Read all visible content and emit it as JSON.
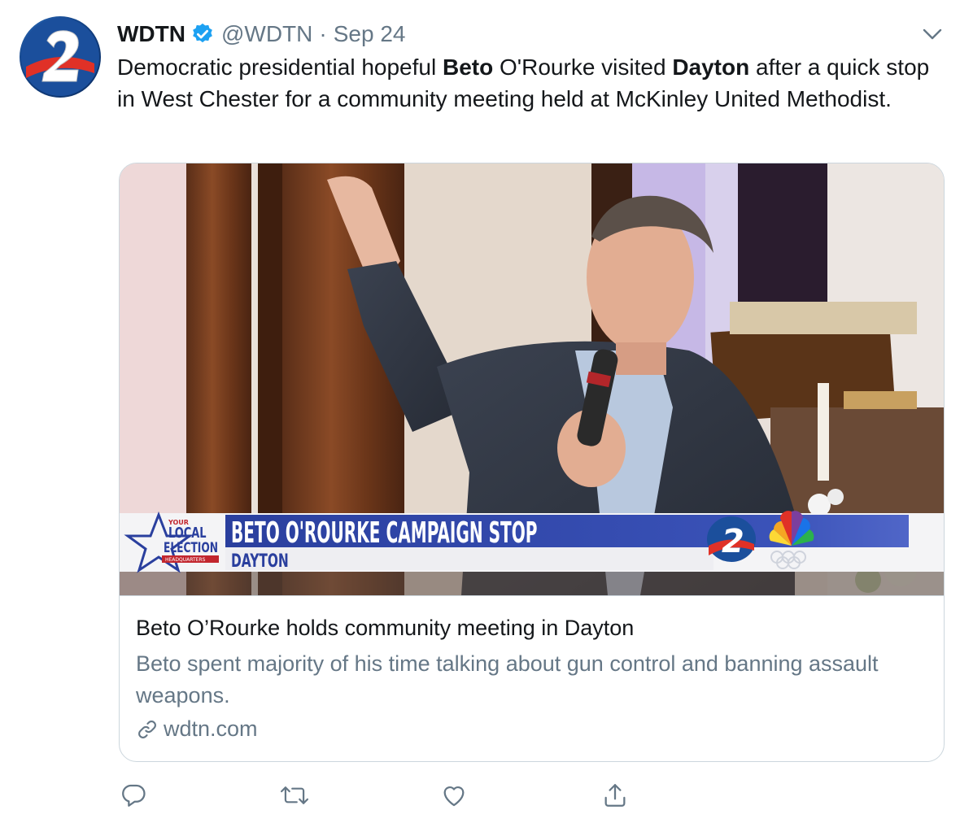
{
  "tweet": {
    "author": {
      "display_name": "WDTN",
      "handle": "@WDTN",
      "verified": true,
      "avatar_icon": "wdtn-2-logo-icon"
    },
    "separator": "·",
    "date": "Sep 24",
    "text_segments": [
      {
        "text": "Democratic presidential hopeful ",
        "bold": false
      },
      {
        "text": "Beto",
        "bold": true
      },
      {
        "text": " O'Rourke visited ",
        "bold": false
      },
      {
        "text": "Dayton",
        "bold": true
      },
      {
        "text": " after a quick stop in West Chester for a community meeting held at McKinley United Methodist.",
        "bold": false
      }
    ],
    "card": {
      "image_overlay": {
        "badge_line1": "YOUR",
        "badge_line2": "LOCAL",
        "badge_line3": "ELECTION",
        "badge_line4": "HEADQUARTERS",
        "headline": "BETO O'ROURKE CAMPAIGN STOP",
        "location": "DAYTON"
      },
      "title": "Beto O’Rourke holds community meeting in Dayton",
      "description": "Beto spent majority of his time talking about gun control and banning assault weapons.",
      "domain": "wdtn.com"
    },
    "actions": [
      {
        "name": "reply",
        "icon": "reply-icon"
      },
      {
        "name": "retweet",
        "icon": "retweet-icon"
      },
      {
        "name": "like",
        "icon": "heart-icon"
      },
      {
        "name": "share",
        "icon": "share-icon"
      }
    ],
    "colors": {
      "text": "#14171a",
      "secondary": "#657786",
      "border": "#ccd6dd",
      "verified": "#1da1f2",
      "lower_third_blue": "#2a3f9e"
    }
  }
}
